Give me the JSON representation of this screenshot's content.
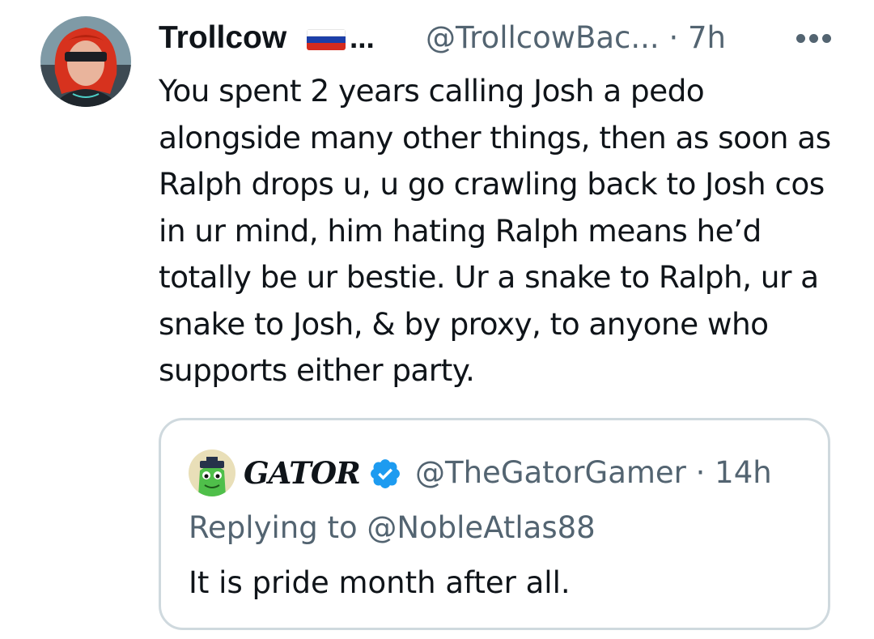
{
  "tweet": {
    "display_name": "Trollcow",
    "name_ellipsis": "...",
    "flag_icon": "russia-flag-icon",
    "handle_time": "@TrollcowBac... · 7h",
    "more_icon": "more-dots-icon",
    "text": "You spent 2 years calling Josh a pedo alongside many other things, then as soon as Ralph drops u, u go crawling back to Josh cos in ur mind, him hating Ralph means he’d totally be ur bestie. Ur a snake to Ralph, ur a snake to Josh, & by proxy, to anyone who supports either party."
  },
  "quoted": {
    "display_name": "GATOR",
    "verified_icon": "verified-badge-icon",
    "handle_time": "@TheGatorGamer · 14h",
    "replying_to": "Replying to @NobleAtlas88",
    "text": "It is pride month after all."
  },
  "colors": {
    "text": "#0f1419",
    "secondary": "#536471",
    "border": "#cfd9de",
    "verified": "#1d9bf0"
  }
}
